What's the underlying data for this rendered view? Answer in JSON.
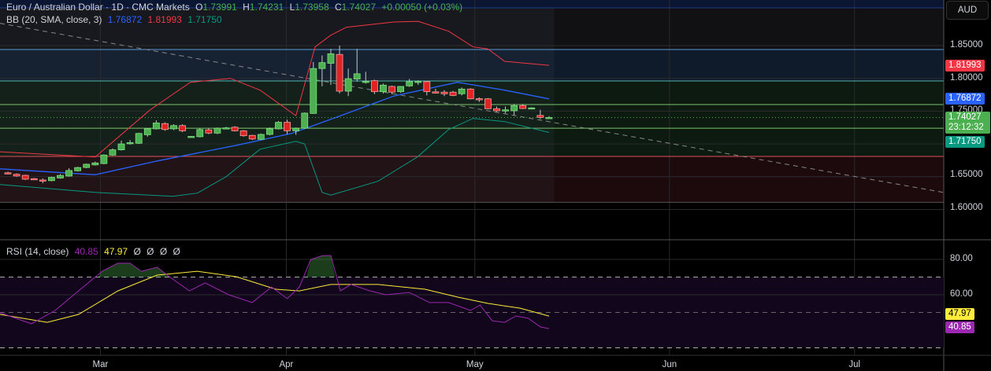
{
  "header": {
    "symbol": "Euro / Australian Dollar · 1D · CMC Markets",
    "o_label": "O",
    "o": "1.73991",
    "h_label": "H",
    "h": "1.74231",
    "l_label": "L",
    "l": "1.73958",
    "c_label": "C",
    "c": "1.74027",
    "change": "+0.00050 (+0.03%)"
  },
  "bb_legend": {
    "name": "BB (20, SMA, close, 3)",
    "basis": "1.76872",
    "upper": "1.81993",
    "lower": "1.71750"
  },
  "rsi_legend": {
    "name": "RSI (14, close)",
    "rsi": "40.85",
    "ma": "47.97",
    "na": [
      "Ø",
      "Ø",
      "Ø",
      "Ø"
    ]
  },
  "price_axis": {
    "currency": "AUD",
    "ticks": [
      "1.85000",
      "1.80000",
      "1.75000",
      "1.65000",
      "1.60000"
    ],
    "upper_label": "1.81993",
    "basis_label": "1.76872",
    "last_price": "1.74027",
    "countdown": "23:12:32",
    "lower_label": "1.71750"
  },
  "rsi_axis": {
    "ticks": [
      "80.00",
      "60.00"
    ],
    "ma_label": "47.97",
    "rsi_label": "40.85"
  },
  "colors": {
    "up": "#4caf50",
    "down": "#e02424",
    "upper": "#f23645",
    "basis": "#2962ff",
    "lower": "#089981",
    "rsi": "#9c27b0",
    "rsi_ma": "#ffeb3b",
    "last": "#4caf50"
  },
  "chart_data": {
    "type": "candlestick",
    "title": "Euro / Australian Dollar · 1D · CMC Markets",
    "x_unit": "bar index",
    "months": [
      {
        "label": "Mar",
        "bar": 10.6
      },
      {
        "label": "Apr",
        "bar": 31.9
      },
      {
        "label": "May",
        "bar": 53.5
      },
      {
        "label": "Jun",
        "bar": 75.8
      },
      {
        "label": "Jul",
        "bar": 97
      }
    ],
    "ylim": [
      1.575,
      1.92
    ],
    "price_ticks": [
      1.85,
      1.8,
      1.75,
      1.7,
      1.65,
      1.6
    ],
    "candles": [
      [
        1.656,
        1.6575,
        1.6535,
        1.6545
      ],
      [
        1.6537,
        1.655,
        1.65,
        1.6511
      ],
      [
        1.6521,
        1.653,
        1.645,
        1.6462
      ],
      [
        1.647,
        1.648,
        1.645,
        1.646
      ],
      [
        1.645,
        1.6475,
        1.64,
        1.644
      ],
      [
        1.644,
        1.65,
        1.643,
        1.649
      ],
      [
        1.648,
        1.654,
        1.647,
        1.652
      ],
      [
        1.651,
        1.663,
        1.65,
        1.6595
      ],
      [
        1.659,
        1.665,
        1.658,
        1.664
      ],
      [
        1.664,
        1.67,
        1.663,
        1.669
      ],
      [
        1.668,
        1.673,
        1.667,
        1.671
      ],
      [
        1.67,
        1.684,
        1.669,
        1.683
      ],
      [
        1.683,
        1.693,
        1.682,
        1.691
      ],
      [
        1.691,
        1.705,
        1.69,
        1.7
      ],
      [
        1.7015,
        1.706,
        1.699,
        1.702
      ],
      [
        1.701,
        1.717,
        1.7,
        1.716
      ],
      [
        1.714,
        1.724,
        1.711,
        1.723
      ],
      [
        1.723,
        1.736,
        1.722,
        1.732
      ],
      [
        1.731,
        1.733,
        1.72,
        1.722
      ],
      [
        1.723,
        1.73,
        1.721,
        1.728
      ],
      [
        1.728,
        1.73,
        1.718,
        1.72
      ],
      [
        1.711,
        1.712,
        1.71,
        1.7115
      ],
      [
        1.711,
        1.724,
        1.71,
        1.722
      ],
      [
        1.7215,
        1.724,
        1.715,
        1.7165
      ],
      [
        1.7165,
        1.725,
        1.715,
        1.724
      ],
      [
        1.7245,
        1.726,
        1.723,
        1.7245
      ],
      [
        1.7255,
        1.727,
        1.719,
        1.72
      ],
      [
        1.72,
        1.721,
        1.711,
        1.7125
      ],
      [
        1.713,
        1.714,
        1.706,
        1.7075
      ],
      [
        1.707,
        1.716,
        1.706,
        1.7145
      ],
      [
        1.7145,
        1.725,
        1.713,
        1.723
      ],
      [
        1.723,
        1.735,
        1.722,
        1.733
      ],
      [
        1.733,
        1.737,
        1.715,
        1.72
      ],
      [
        1.72,
        1.725,
        1.714,
        1.724
      ],
      [
        1.724,
        1.748,
        1.723,
        1.747
      ],
      [
        1.7465,
        1.825,
        1.746,
        1.815
      ],
      [
        1.815,
        1.835,
        1.788,
        1.824
      ],
      [
        1.823,
        1.845,
        1.79,
        1.8375
      ],
      [
        1.8365,
        1.85,
        1.777,
        1.7805
      ],
      [
        1.7805,
        1.815,
        1.773,
        1.7995
      ],
      [
        1.799,
        1.845,
        1.795,
        1.807
      ],
      [
        1.795,
        1.81,
        1.792,
        1.7955
      ],
      [
        1.7965,
        1.798,
        1.776,
        1.7797
      ],
      [
        1.7797,
        1.792,
        1.777,
        1.7897
      ],
      [
        1.7877,
        1.789,
        1.776,
        1.779
      ],
      [
        1.7797,
        1.788,
        1.778,
        1.7877
      ],
      [
        1.7885,
        1.799,
        1.787,
        1.795
      ],
      [
        1.795,
        1.797,
        1.79,
        1.7955
      ],
      [
        1.795,
        1.796,
        1.774,
        1.7797
      ],
      [
        1.7795,
        1.784,
        1.777,
        1.7775
      ],
      [
        1.779,
        1.782,
        1.773,
        1.7765
      ],
      [
        1.779,
        1.781,
        1.773,
        1.774
      ],
      [
        1.7765,
        1.786,
        1.774,
        1.7837
      ],
      [
        1.7837,
        1.785,
        1.768,
        1.7688
      ],
      [
        1.769,
        1.771,
        1.764,
        1.7688
      ],
      [
        1.7688,
        1.77,
        1.753,
        1.7537
      ],
      [
        1.7537,
        1.757,
        1.749,
        1.7505
      ],
      [
        1.7505,
        1.757,
        1.747,
        1.752
      ],
      [
        1.7505,
        1.761,
        1.744,
        1.7585
      ],
      [
        1.7585,
        1.761,
        1.753,
        1.754
      ],
      [
        1.755,
        1.756,
        1.754,
        1.755
      ],
      [
        1.7435,
        1.752,
        1.738,
        1.7405
      ],
      [
        1.73991,
        1.74231,
        1.73958,
        1.74027
      ]
    ],
    "bb_upper": [
      [
        -0.9,
        1.688
      ],
      [
        10,
        1.68
      ],
      [
        16.3,
        1.752
      ],
      [
        20.9,
        1.794
      ],
      [
        25.5,
        1.8
      ],
      [
        28.9,
        1.782
      ],
      [
        33,
        1.743
      ],
      [
        35.2,
        1.848
      ],
      [
        37,
        1.866
      ],
      [
        38.8,
        1.878
      ],
      [
        44.2,
        1.886
      ],
      [
        47,
        1.887
      ],
      [
        50.5,
        1.872
      ],
      [
        53.3,
        1.848
      ],
      [
        55,
        1.845
      ],
      [
        56.9,
        1.826
      ],
      [
        62,
        1.8199
      ]
    ],
    "bb_basis": [
      [
        -0.9,
        1.662
      ],
      [
        10,
        1.653
      ],
      [
        17.1,
        1.674
      ],
      [
        26.2,
        1.698
      ],
      [
        32.5,
        1.716
      ],
      [
        37.9,
        1.742
      ],
      [
        44.2,
        1.773
      ],
      [
        51.5,
        1.794
      ],
      [
        53.3,
        1.79
      ],
      [
        56.9,
        1.782
      ],
      [
        62,
        1.7687
      ]
    ],
    "bb_lower": [
      [
        -0.9,
        1.638
      ],
      [
        10,
        1.626
      ],
      [
        18.9,
        1.62
      ],
      [
        21.7,
        1.625
      ],
      [
        25,
        1.65
      ],
      [
        28.9,
        1.692
      ],
      [
        33,
        1.704
      ],
      [
        34,
        1.7
      ],
      [
        36,
        1.626
      ],
      [
        37,
        1.622
      ],
      [
        42.4,
        1.643
      ],
      [
        46.9,
        1.68
      ],
      [
        50.5,
        1.722
      ],
      [
        53.3,
        1.739
      ],
      [
        56.9,
        1.734
      ],
      [
        62,
        1.7175
      ]
    ],
    "rsi": [
      [
        -0.9,
        49.8
      ],
      [
        2.7,
        43.6
      ],
      [
        5.4,
        51.1
      ],
      [
        8.1,
        62.2
      ],
      [
        10.8,
        73.3
      ],
      [
        12.6,
        77.8
      ],
      [
        14,
        77.8
      ],
      [
        15.3,
        73.3
      ],
      [
        17.1,
        75.6
      ],
      [
        18.5,
        70.2
      ],
      [
        20.8,
        62.2
      ],
      [
        22.6,
        66.7
      ],
      [
        25.3,
        60
      ],
      [
        28,
        55.6
      ],
      [
        30.2,
        64.4
      ],
      [
        32,
        57.8
      ],
      [
        33.4,
        64.4
      ],
      [
        34.7,
        80
      ],
      [
        36.1,
        82.2
      ],
      [
        37,
        82.2
      ],
      [
        38.1,
        62.2
      ],
      [
        39.3,
        65.8
      ],
      [
        41.5,
        62.2
      ],
      [
        43.3,
        60
      ],
      [
        46,
        61.3
      ],
      [
        48.3,
        55.6
      ],
      [
        50.5,
        55.6
      ],
      [
        53,
        51.1
      ],
      [
        54.1,
        54.2
      ],
      [
        55.5,
        45.3
      ],
      [
        56.9,
        44.4
      ],
      [
        58.2,
        48
      ],
      [
        59.6,
        46.7
      ],
      [
        61,
        41.8
      ],
      [
        62,
        40.85
      ]
    ],
    "rsi_ma": [
      [
        -0.9,
        48.9
      ],
      [
        4.5,
        44.4
      ],
      [
        8.1,
        48.9
      ],
      [
        12.6,
        62.2
      ],
      [
        17.1,
        71.1
      ],
      [
        21.7,
        73.3
      ],
      [
        26.2,
        70.2
      ],
      [
        30.7,
        63.1
      ],
      [
        33.4,
        62.2
      ],
      [
        37,
        65.8
      ],
      [
        42.4,
        65.8
      ],
      [
        47.8,
        63.1
      ],
      [
        51.5,
        58.7
      ],
      [
        55,
        55.1
      ],
      [
        58.7,
        52.4
      ],
      [
        62,
        47.97
      ]
    ],
    "rsi_levels": {
      "upper": 70,
      "middle": 50,
      "lower": 30
    },
    "rsi_ticks": [
      80,
      60
    ],
    "levels": [
      {
        "price": 1.9076,
        "color": "#1e3a8a"
      },
      {
        "price": 1.844,
        "color": "#5b9bd5"
      },
      {
        "price": 1.796,
        "color": "#4db6ac"
      },
      {
        "price": 1.76,
        "color": "#7cc36b"
      },
      {
        "price": 1.724,
        "color": "#7cc36b"
      },
      {
        "price": 1.681,
        "color": "#e0525a"
      },
      {
        "price": 1.611,
        "color": "#555555"
      }
    ],
    "trendline": [
      [
        -0.9,
        1.884
      ],
      [
        107.2,
        1.626
      ]
    ]
  }
}
